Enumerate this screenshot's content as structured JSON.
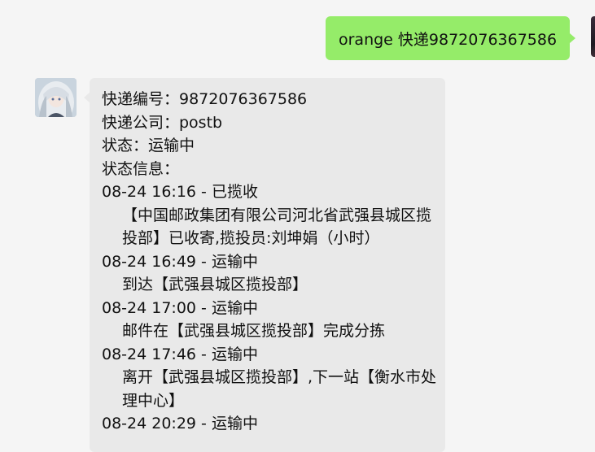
{
  "outgoing": {
    "text": "orange 快递9872076367586"
  },
  "incoming": {
    "tracking_line": "快递编号：9872076367586",
    "company_line": "快递公司：postb",
    "status_line": "状态：运输中",
    "info_header": "状态信息：",
    "events": [
      {
        "time": "08-24 16:16 - 已揽收",
        "detail": "【中国邮政集团有限公司河北省武强县城区揽投部】已收寄,揽投员:刘坤娟（小时）"
      },
      {
        "time": "08-24 16:49 - 运输中",
        "detail": "到达【武强县城区揽投部】"
      },
      {
        "time": "08-24 17:00 - 运输中",
        "detail": "邮件在【武强县城区揽投部】完成分拣"
      },
      {
        "time": "08-24 17:46 - 运输中",
        "detail": "离开【武强县城区揽投部】,下一站【衡水市处理中心】"
      },
      {
        "time": "08-24 20:29 - 运输中",
        "detail": ""
      }
    ]
  },
  "colors": {
    "background": "#f5f5f5",
    "outgoing_bubble": "#95ec69",
    "incoming_bubble": "#e9e9e9"
  }
}
